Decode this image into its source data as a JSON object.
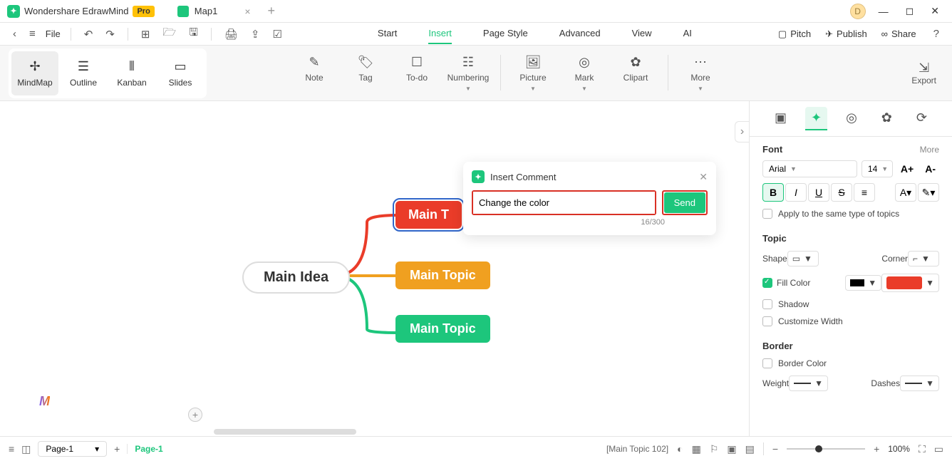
{
  "titlebar": {
    "app_name": "Wondershare EdrawMind",
    "pro_label": "Pro",
    "doc_name": "Map1",
    "user_initial": "D"
  },
  "menubar": {
    "file_label": "File",
    "items": [
      "Start",
      "Insert",
      "Page Style",
      "Advanced",
      "View",
      "AI"
    ],
    "active_index": 1,
    "right": {
      "pitch": "Pitch",
      "publish": "Publish",
      "share": "Share"
    }
  },
  "ribbon": {
    "views": [
      "MindMap",
      "Outline",
      "Kanban",
      "Slides"
    ],
    "active_view": 0,
    "tools": [
      "Note",
      "Tag",
      "To-do",
      "Numbering",
      "Picture",
      "Mark",
      "Clipart",
      "More"
    ],
    "export_label": "Export"
  },
  "canvas": {
    "main_idea": "Main Idea",
    "topic1": "Main T",
    "topic2": "Main Topic",
    "topic3": "Main Topic"
  },
  "comment": {
    "title": "Insert Comment",
    "value": "Change the color",
    "send_label": "Send",
    "counter": "16/300"
  },
  "panel": {
    "font": {
      "header": "Font",
      "more": "More",
      "family": "Arial",
      "size": "14",
      "increase": "A+",
      "decrease": "A-",
      "apply_label": "Apply to the same type of topics"
    },
    "topic": {
      "header": "Topic",
      "shape_label": "Shape",
      "corner_label": "Corner",
      "fill_label": "Fill Color",
      "shadow_label": "Shadow",
      "custom_width_label": "Customize Width"
    },
    "border": {
      "header": "Border",
      "color_label": "Border Color",
      "weight_label": "Weight",
      "dashes_label": "Dashes"
    }
  },
  "statusbar": {
    "page_current": "Page-1",
    "page_tab": "Page-1",
    "selection": "[Main Topic 102]",
    "zoom": "100%"
  }
}
